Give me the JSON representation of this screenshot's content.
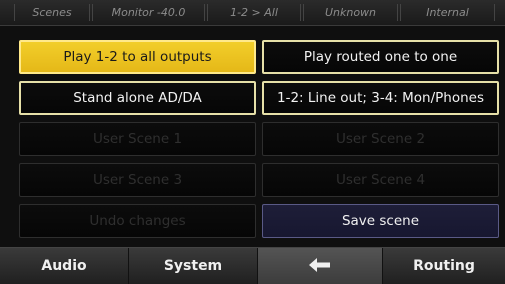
{
  "status_bar": [
    "Scenes",
    "Monitor -40.0",
    "1-2 > All",
    "Unknown",
    "Internal"
  ],
  "scenes": [
    {
      "label": "Play 1-2 to all outputs",
      "state": "selected"
    },
    {
      "label": "Play routed one to one",
      "state": "active"
    },
    {
      "label": "Stand alone AD/DA",
      "state": "active"
    },
    {
      "label": "1-2: Line out; 3-4: Mon/Phones",
      "state": "active"
    },
    {
      "label": "User Scene 1",
      "state": "disabled"
    },
    {
      "label": "User Scene 2",
      "state": "disabled"
    },
    {
      "label": "User Scene 3",
      "state": "disabled"
    },
    {
      "label": "User Scene 4",
      "state": "disabled"
    }
  ],
  "actions": {
    "undo_label": "Undo changes",
    "save_label": "Save scene"
  },
  "tabs": {
    "audio": "Audio",
    "system": "System",
    "back_icon": "back-arrow-icon",
    "routing": "Routing"
  },
  "colors": {
    "selected_bg": "#f0c824",
    "active_border": "#e6e0a8",
    "save_bg": "#1c1c36"
  }
}
